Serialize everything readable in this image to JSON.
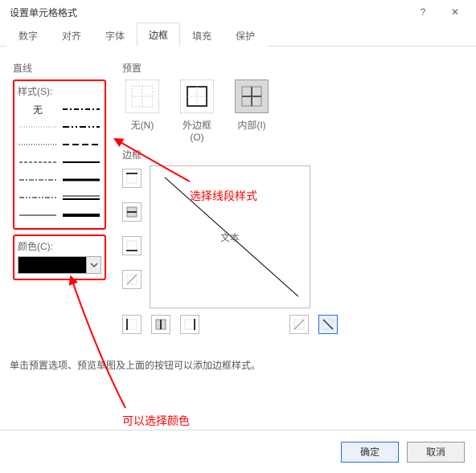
{
  "window": {
    "title": "设置单元格格式",
    "help": "?",
    "close": "✕"
  },
  "tabs": [
    "数字",
    "对齐",
    "字体",
    "边框",
    "填充",
    "保护"
  ],
  "activeTab": 3,
  "groups": {
    "line": "直线",
    "preset": "预置",
    "border": "边框"
  },
  "style": {
    "label": "样式(S):",
    "none": "无"
  },
  "color": {
    "label": "颜色(C):",
    "value": "#000000"
  },
  "presets": {
    "none": "无(N)",
    "outer": "外边框(O)",
    "inner": "内部(I)"
  },
  "preview": {
    "text": "文本"
  },
  "hint": "单击预置选项、预览草图及上面的按钮可以添加边框样式。",
  "annotations": {
    "selectLineStyle": "选择线段样式",
    "selectColor": "可以选择颜色"
  },
  "buttons": {
    "ok": "确定",
    "cancel": "取消"
  }
}
